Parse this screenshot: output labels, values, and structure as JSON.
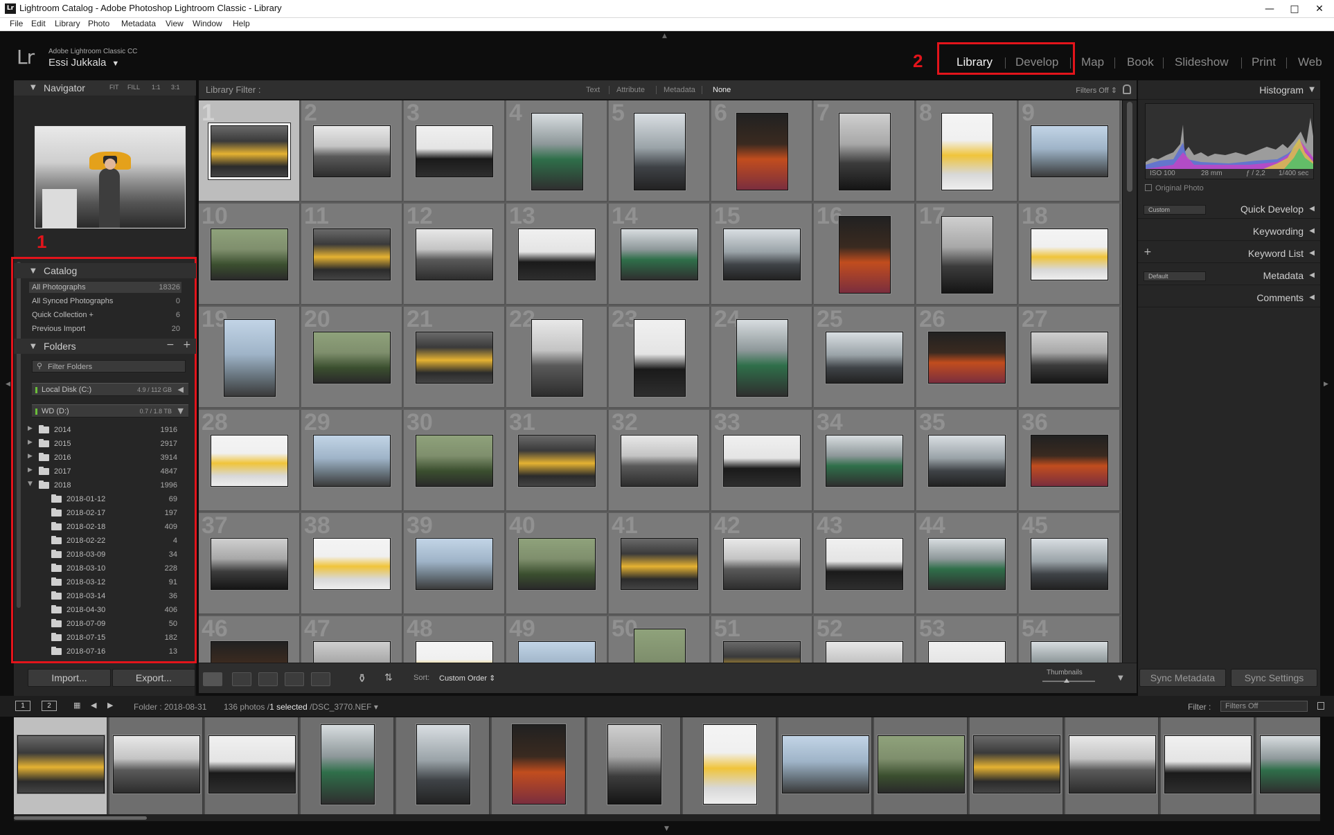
{
  "window": {
    "title": "Lightroom Catalog - Adobe Photoshop Lightroom Classic - Library",
    "app_icon": "Lr",
    "controls": [
      "minimize-icon",
      "maximize-icon",
      "close-icon"
    ]
  },
  "menu": [
    "File",
    "Edit",
    "Library",
    "Photo",
    "Metadata",
    "View",
    "Window",
    "Help"
  ],
  "identity": {
    "logo": "Lr",
    "product": "Adobe Lightroom Classic CC",
    "user": "Essi Jukkala",
    "user_caret": "▼"
  },
  "modules": [
    {
      "label": "Library",
      "active": true
    },
    {
      "label": "Develop",
      "active": false
    },
    {
      "label": "Map",
      "active": false
    },
    {
      "label": "Book",
      "active": false
    },
    {
      "label": "Slideshow",
      "active": false
    },
    {
      "label": "Print",
      "active": false
    },
    {
      "label": "Web",
      "active": false
    }
  ],
  "annotations": {
    "left_marker": "1",
    "top_marker": "2",
    "accent": "#e3141b"
  },
  "navigator": {
    "title": "Navigator",
    "options": [
      "FIT",
      "FILL",
      "1:1",
      "3:1"
    ]
  },
  "catalog": {
    "title": "Catalog",
    "items": [
      {
        "label": "All Photographs",
        "count": "18326",
        "selected": true
      },
      {
        "label": "All Synced Photographs",
        "count": "0",
        "selected": false
      },
      {
        "label": "Quick Collection +",
        "count": "6",
        "selected": false
      },
      {
        "label": "Previous Import",
        "count": "20",
        "selected": false
      }
    ]
  },
  "folders": {
    "title": "Folders",
    "minus": "−",
    "plus": "+",
    "filter_placeholder": "Filter Folders",
    "volumes": [
      {
        "name": "Local Disk (C:)",
        "space": "4.9 / 112 GB",
        "arrow": "◀"
      },
      {
        "name": "WD (D:)",
        "space": "0.7 / 1.8 TB",
        "arrow": "▼"
      }
    ],
    "years": [
      {
        "name": "2014",
        "count": "1916",
        "expanded": false
      },
      {
        "name": "2015",
        "count": "2917",
        "expanded": false
      },
      {
        "name": "2016",
        "count": "3914",
        "expanded": false
      },
      {
        "name": "2017",
        "count": "4847",
        "expanded": false
      },
      {
        "name": "2018",
        "count": "1996",
        "expanded": true
      }
    ],
    "subfolders": [
      {
        "name": "2018-01-12",
        "count": "69"
      },
      {
        "name": "2018-02-17",
        "count": "197"
      },
      {
        "name": "2018-02-18",
        "count": "409"
      },
      {
        "name": "2018-02-22",
        "count": "4"
      },
      {
        "name": "2018-03-09",
        "count": "34"
      },
      {
        "name": "2018-03-10",
        "count": "228"
      },
      {
        "name": "2018-03-12",
        "count": "91"
      },
      {
        "name": "2018-03-14",
        "count": "36"
      },
      {
        "name": "2018-04-30",
        "count": "406"
      },
      {
        "name": "2018-07-09",
        "count": "50"
      },
      {
        "name": "2018-07-15",
        "count": "182"
      },
      {
        "name": "2018-07-16",
        "count": "13"
      }
    ]
  },
  "left_buttons": {
    "import": "Import...",
    "export": "Export..."
  },
  "filter_bar": {
    "label": "Library Filter :",
    "tabs": [
      {
        "label": "Text",
        "active": false
      },
      {
        "label": "Attribute",
        "active": false
      },
      {
        "label": "Metadata",
        "active": false
      },
      {
        "label": "None",
        "active": true
      }
    ],
    "preset": "Filters Off ⇕"
  },
  "grid": {
    "selected_index": 1,
    "cells": [
      {
        "n": "1",
        "o": "l"
      },
      {
        "n": "2",
        "o": "l"
      },
      {
        "n": "3",
        "o": "l"
      },
      {
        "n": "4",
        "o": "p"
      },
      {
        "n": "5",
        "o": "p"
      },
      {
        "n": "6",
        "o": "p"
      },
      {
        "n": "7",
        "o": "p"
      },
      {
        "n": "8",
        "o": "p"
      },
      {
        "n": "9",
        "o": "l"
      },
      {
        "n": "10",
        "o": "l"
      },
      {
        "n": "11",
        "o": "l"
      },
      {
        "n": "12",
        "o": "l"
      },
      {
        "n": "13",
        "o": "l"
      },
      {
        "n": "14",
        "o": "l"
      },
      {
        "n": "15",
        "o": "l"
      },
      {
        "n": "16",
        "o": "p"
      },
      {
        "n": "17",
        "o": "p"
      },
      {
        "n": "18",
        "o": "l"
      },
      {
        "n": "19",
        "o": "p"
      },
      {
        "n": "20",
        "o": "l"
      },
      {
        "n": "21",
        "o": "l"
      },
      {
        "n": "22",
        "o": "p"
      },
      {
        "n": "23",
        "o": "p"
      },
      {
        "n": "24",
        "o": "p"
      },
      {
        "n": "25",
        "o": "l"
      },
      {
        "n": "26",
        "o": "l"
      },
      {
        "n": "27",
        "o": "l"
      },
      {
        "n": "28",
        "o": "l"
      },
      {
        "n": "29",
        "o": "l"
      },
      {
        "n": "30",
        "o": "l"
      },
      {
        "n": "31",
        "o": "l"
      },
      {
        "n": "32",
        "o": "l"
      },
      {
        "n": "33",
        "o": "l"
      },
      {
        "n": "34",
        "o": "l"
      },
      {
        "n": "35",
        "o": "l"
      },
      {
        "n": "36",
        "o": "l"
      },
      {
        "n": "37",
        "o": "l"
      },
      {
        "n": "38",
        "o": "l"
      },
      {
        "n": "39",
        "o": "l"
      },
      {
        "n": "40",
        "o": "l"
      },
      {
        "n": "41",
        "o": "l"
      },
      {
        "n": "42",
        "o": "l"
      },
      {
        "n": "43",
        "o": "l"
      },
      {
        "n": "44",
        "o": "l"
      },
      {
        "n": "45",
        "o": "l"
      },
      {
        "n": "46",
        "o": "l"
      },
      {
        "n": "47",
        "o": "l"
      },
      {
        "n": "48",
        "o": "l"
      },
      {
        "n": "49",
        "o": "l"
      },
      {
        "n": "50",
        "o": "p"
      },
      {
        "n": "51",
        "o": "l"
      },
      {
        "n": "52",
        "o": "l"
      },
      {
        "n": "53",
        "o": "l"
      },
      {
        "n": "54",
        "o": "l"
      }
    ]
  },
  "toolbar": {
    "sort_label": "Sort:",
    "sort_value": "Custom Order ⇕",
    "thumbnails_label": "Thumbnails",
    "dropdown": "▼"
  },
  "right_panel": {
    "histogram": {
      "title": "Histogram",
      "iso": "ISO 100",
      "focal": "28 mm",
      "aperture": "ƒ / 2,2",
      "shutter": "1/400 sec"
    },
    "original_photo": "Original Photo",
    "sections": [
      {
        "title": "Quick Develop",
        "dropdown": "Custom"
      },
      {
        "title": "Keywording"
      },
      {
        "title": "Keyword List",
        "plus": "+"
      },
      {
        "title": "Metadata",
        "dropdown": "Default"
      },
      {
        "title": "Comments"
      }
    ],
    "sync_metadata": "Sync Metadata",
    "sync_settings": "Sync Settings"
  },
  "filmstrip_bar": {
    "monitor1": "1",
    "monitor2": "2",
    "folder": "Folder : 2018-08-31",
    "count_prefix": "136 photos /",
    "count_selected": "1 selected",
    "count_path": "/DSC_3770.NEF ▾",
    "filter_label": "Filter :",
    "filter_value": "Filters Off"
  },
  "filmstrip": {
    "selected_index": 1,
    "frames": [
      "l",
      "l",
      "l",
      "p",
      "p",
      "p",
      "p",
      "p",
      "l",
      "l",
      "l",
      "l",
      "l",
      "l"
    ]
  }
}
